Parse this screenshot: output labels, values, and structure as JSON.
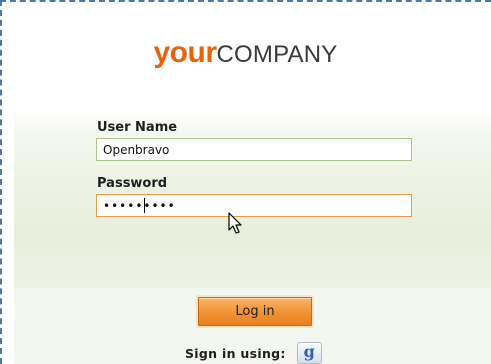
{
  "logo": {
    "part1": "your",
    "part2": "COMPANY"
  },
  "form": {
    "username_label": "User Name",
    "username_value": "Openbravo",
    "password_label": "Password",
    "password_value": "openbravo"
  },
  "actions": {
    "login_label": "Log in",
    "signin_label": "Sign in using:",
    "google_glyph": "g"
  },
  "icons": {
    "google": "google-icon",
    "pointer": "mouse-pointer-icon"
  },
  "colors": {
    "brand_orange": "#e8630d",
    "button_orange": "#f19234",
    "frame_dashed": "#4b78a8",
    "panel_green": "#e7efdb"
  }
}
